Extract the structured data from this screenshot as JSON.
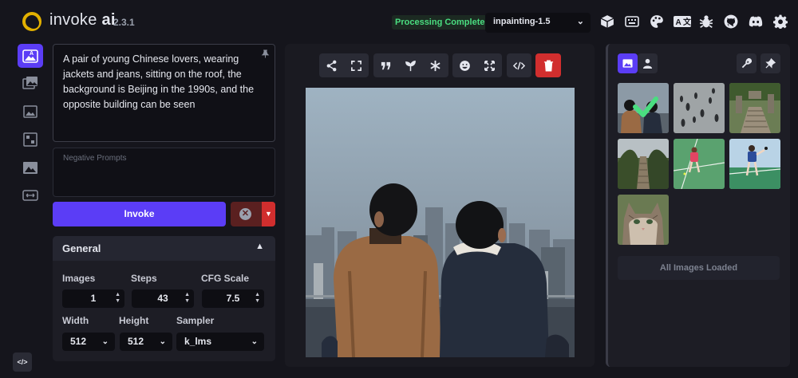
{
  "header": {
    "brand": "invoke",
    "brand_suffix": "ai",
    "version": "2.3.1",
    "status": "Processing Complete",
    "model": "inpainting-1.5",
    "icons": [
      "model-manager-icon",
      "hotkeys-icon",
      "theme-icon",
      "language-icon",
      "bug-icon",
      "github-icon",
      "discord-icon",
      "settings-icon"
    ]
  },
  "sidebar": {
    "items": [
      "text-to-image",
      "image-to-image",
      "unified-canvas",
      "nodes",
      "postprocessing",
      "training"
    ]
  },
  "prompt": {
    "value": "A pair of young Chinese lovers, wearing jackets and jeans, sitting on the roof, the background is Beijing in the 1990s, and the opposite building can be seen",
    "negative_placeholder": "Negative Prompts"
  },
  "actions": {
    "invoke": "Invoke"
  },
  "general": {
    "title": "General",
    "images_label": "Images",
    "images": "1",
    "steps_label": "Steps",
    "steps": "43",
    "cfg_label": "CFG Scale",
    "cfg": "7.5",
    "width_label": "Width",
    "width": "512",
    "height_label": "Height",
    "height": "512",
    "sampler_label": "Sampler",
    "sampler": "k_lms"
  },
  "gallery": {
    "all_loaded": "All Images Loaded"
  },
  "colors": {
    "accent": "#5b3df6",
    "danger": "#d12e2e",
    "status": "#4ade80"
  }
}
